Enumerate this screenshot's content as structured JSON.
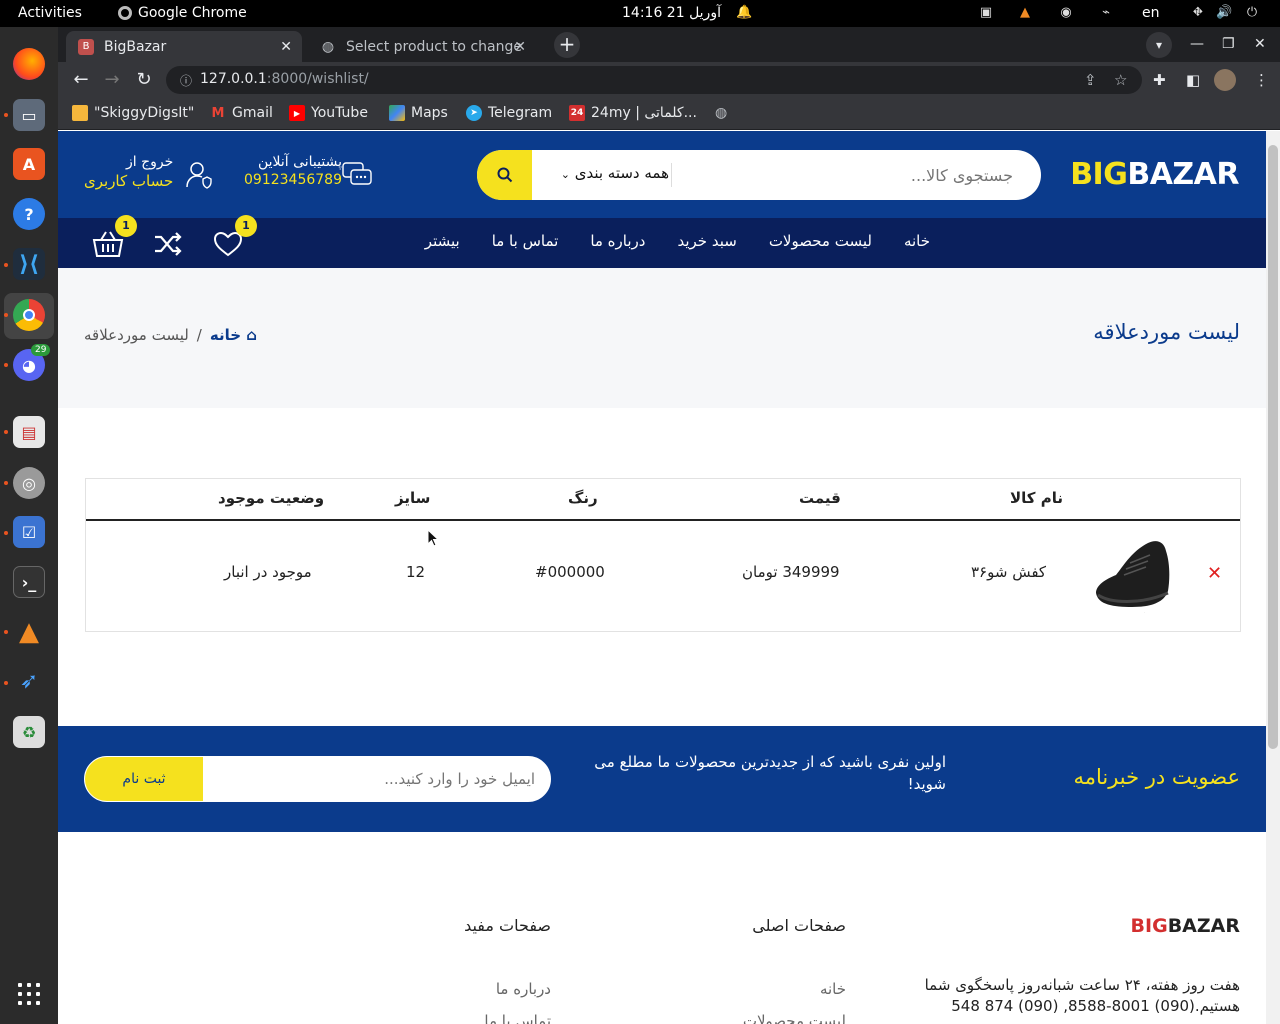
{
  "os": {
    "activities": "Activities",
    "app_name": "Google Chrome",
    "clock": "14:16  21 آوریل",
    "lang": "en"
  },
  "dock": {
    "discord_badge": "29"
  },
  "browser": {
    "tabs": [
      {
        "title": "BigBazar",
        "favicon": "B"
      },
      {
        "title": "Select product to change"
      }
    ],
    "url_host": "127.0.0.1",
    "url_path": ":8000/wishlist/",
    "bookmarks": [
      {
        "label": "\"SkiggyDigsIt\"",
        "icon": "folder-icon",
        "color": "#f6b73c"
      },
      {
        "label": "Gmail",
        "icon": "gmail-icon",
        "color": "#ea4335"
      },
      {
        "label": "YouTube",
        "icon": "youtube-icon",
        "color": "#ff0000"
      },
      {
        "label": "Maps",
        "icon": "maps-icon",
        "color": "#34a853"
      },
      {
        "label": "Telegram",
        "icon": "telegram-icon",
        "color": "#29a9eb"
      },
      {
        "label": "24my | کلماتی...",
        "icon": "24-icon",
        "color": "#d32f2f"
      }
    ]
  },
  "site": {
    "logo_big": "BIG",
    "logo_bazar": "BAZAR",
    "search_placeholder": "جستجوی کالا...",
    "search_category": "همه دسته بندی",
    "support_label": "پشتیبانی آنلاین",
    "support_phone": "09123456789",
    "account_line1": "خروج از",
    "account_line2": "حساب کاربری",
    "menu": [
      "خانه",
      "لیست محصولات",
      "سبد خرید",
      "درباره ما",
      "تماس با ما",
      "بیشتر"
    ],
    "wishlist_count": "1",
    "cart_count": "1",
    "colors": {
      "primary": "#0b3b8c",
      "nav": "#0a1f5c",
      "accent": "#f5e11e"
    }
  },
  "breadcrumb": {
    "title": "لیست موردعلاقه",
    "home": "خانه",
    "current": "لیست موردعلاقه",
    "separator": "/"
  },
  "wishlist": {
    "headers": {
      "name": "نام کالا",
      "price": "قیمت",
      "color": "رنگ",
      "size": "سایز",
      "stock": "وضعیت موجود"
    },
    "rows": [
      {
        "name": "کفش شو۳۶",
        "price": "349999 تومان",
        "color": "#000000",
        "size": "12",
        "stock": "موجود در انبار"
      }
    ]
  },
  "newsletter": {
    "title": "عضویت در خبرنامه",
    "text": "اولین نفری باشید که از جدیدترین محصولات ما مطلع می شوید!",
    "placeholder": "ایمیل خود را وارد کنید...",
    "button": "ثبت نام"
  },
  "footer": {
    "logo_big": "BIG",
    "logo_bazar": "BAZAR",
    "description": "هفت روز هفته، ۲۴ ساعت شبانه‌روز پاسخگوی شما هستیم.(090) 8001-8588, (090) 874 548",
    "main_pages_title": "صفحات اصلی",
    "main_pages": [
      "خانه",
      "لیست محصولات"
    ],
    "useful_pages_title": "صفحات مفید",
    "useful_pages": [
      "درباره ما",
      "تماس با ما"
    ]
  }
}
